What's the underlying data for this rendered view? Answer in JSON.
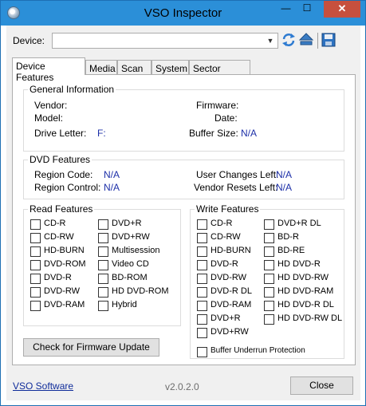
{
  "window": {
    "title": "VSO Inspector",
    "minimize_glyph": "—",
    "maximize_glyph": "☐",
    "close_glyph": "✕"
  },
  "toolbar": {
    "device_label": "Device:",
    "device_value": "",
    "icons": [
      "refresh-icon",
      "eject-icon",
      "save-icon"
    ]
  },
  "tabs": [
    {
      "label": "Device Features",
      "active": true
    },
    {
      "label": "Media",
      "active": false
    },
    {
      "label": "Scan",
      "active": false
    },
    {
      "label": "System",
      "active": false
    },
    {
      "label": "Sector Viewer",
      "active": false
    }
  ],
  "general": {
    "title": "General Information",
    "vendor_label": "Vendor:",
    "vendor_value": "",
    "model_label": "Model:",
    "model_value": "",
    "drive_letter_label": "Drive Letter:",
    "drive_letter_value": "F:",
    "firmware_label": "Firmware:",
    "firmware_value": "",
    "date_label": "Date:",
    "date_value": "",
    "buffer_size_label": "Buffer Size:",
    "buffer_size_value": "N/A"
  },
  "dvd": {
    "title": "DVD Features",
    "region_code_label": "Region Code:",
    "region_code_value": "N/A",
    "region_control_label": "Region Control:",
    "region_control_value": "N/A",
    "user_changes_label": "User Changes Left:",
    "user_changes_value": "N/A",
    "vendor_resets_label": "Vendor Resets Left:",
    "vendor_resets_value": "N/A"
  },
  "read": {
    "title": "Read Features",
    "col1": [
      "CD-R",
      "CD-RW",
      "HD-BURN",
      "DVD-ROM",
      "DVD-R",
      "DVD-RW",
      "DVD-RAM"
    ],
    "col2": [
      "DVD+R",
      "DVD+RW",
      "Multisession",
      "Video CD",
      "BD-ROM",
      "HD DVD-ROM",
      "Hybrid"
    ]
  },
  "write": {
    "title": "Write Features",
    "col1": [
      "CD-R",
      "CD-RW",
      "HD-BURN",
      "DVD-R",
      "DVD-RW",
      "DVD-R DL",
      "DVD-RAM",
      "DVD+R",
      "DVD+RW"
    ],
    "col2": [
      "DVD+R DL",
      "BD-R",
      "BD-RE",
      "HD DVD-R",
      "HD DVD-RW",
      "HD DVD-RAM",
      "HD DVD-R DL",
      "HD DVD-RW DL"
    ],
    "buffer_underrun": "Buffer Underrun Protection"
  },
  "buttons": {
    "firmware_update": "Check for Firmware Update",
    "close": "Close"
  },
  "footer": {
    "link": "VSO Software",
    "version": "v2.0.2.0"
  }
}
